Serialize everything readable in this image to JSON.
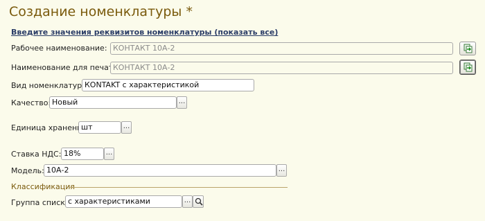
{
  "form": {
    "title": "Создание номенклатуры *",
    "show_all_link": "Введите значения реквизитов номенклатуры (показать все)"
  },
  "fields": {
    "work_name": {
      "label": "Рабочее наименование:",
      "value": "КОНТАКТ 10А-2"
    },
    "print_name": {
      "label": "Наименование для печати:",
      "value": "КОНТАКТ 10А-2"
    },
    "kind": {
      "label": "Вид номенклатуры:",
      "value": "КОNTAKT с характеристикой"
    },
    "quality": {
      "label": "Качество:",
      "value": "Новый",
      "button": "..."
    },
    "unit": {
      "label": "Единица хранения:",
      "value": "шт",
      "button": "..."
    },
    "vat": {
      "label": "Ставка НДС:",
      "value": "18%",
      "button": "..."
    },
    "model": {
      "label": "Модель:",
      "value": "10А-2",
      "button": "..."
    }
  },
  "classification": {
    "label": "Классификация",
    "group": {
      "label": "Группа списка:",
      "value": "с характеристиками",
      "button": "..."
    }
  },
  "icons": {
    "copy_button": "copy-to-field-icon",
    "search_button": "magnifier-icon"
  },
  "colors": {
    "background": "#fbfbeb",
    "title": "#7a5a0c",
    "link": "#2b3d67"
  }
}
